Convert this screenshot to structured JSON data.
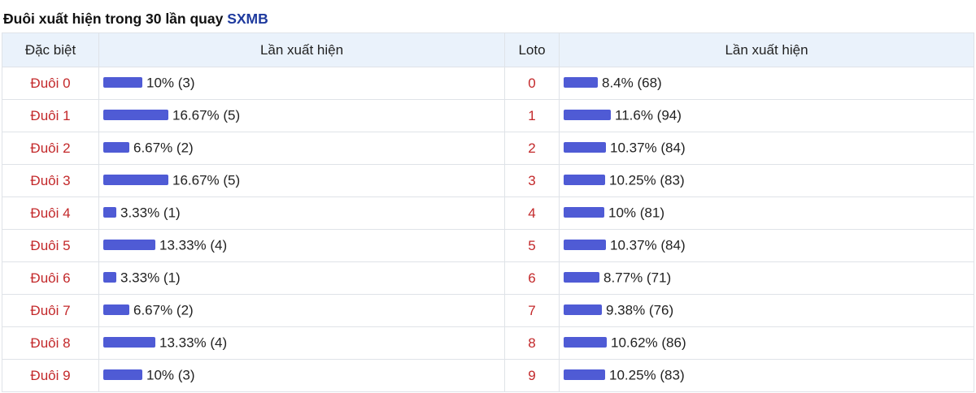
{
  "title": {
    "prefix": "Đuôi xuất hiện trong 30 lần quay",
    "brand": "SXMB"
  },
  "headers": {
    "dac_biet": "Đặc biệt",
    "lan_xuat_hien_1": "Lần xuất hiện",
    "loto": "Loto",
    "lan_xuat_hien_2": "Lần xuất hiện"
  },
  "colors": {
    "bar": "#4f5bd5",
    "label": "#c3282a",
    "brand": "#1e3a9e",
    "header_bg": "#eaf2fb"
  },
  "chart_data": [
    {
      "type": "bar",
      "title": "Đặc biệt",
      "categories": [
        "Đuôi 0",
        "Đuôi 1",
        "Đuôi 2",
        "Đuôi 3",
        "Đuôi 4",
        "Đuôi 5",
        "Đuôi 6",
        "Đuôi 7",
        "Đuôi 8",
        "Đuôi 9"
      ],
      "values": [
        10,
        16.67,
        6.67,
        16.67,
        3.33,
        13.33,
        3.33,
        6.67,
        13.33,
        10
      ],
      "counts": [
        3,
        5,
        2,
        5,
        1,
        4,
        1,
        2,
        4,
        3
      ],
      "labels": [
        "10% (3)",
        "16.67% (5)",
        "6.67% (2)",
        "16.67% (5)",
        "3.33% (1)",
        "13.33% (4)",
        "3.33% (1)",
        "6.67% (2)",
        "13.33% (4)",
        "10% (3)"
      ]
    },
    {
      "type": "bar",
      "title": "Loto",
      "categories": [
        "0",
        "1",
        "2",
        "3",
        "4",
        "5",
        "6",
        "7",
        "8",
        "9"
      ],
      "values": [
        8.4,
        11.6,
        10.37,
        10.25,
        10,
        10.37,
        8.77,
        9.38,
        10.62,
        10.25
      ],
      "counts": [
        68,
        94,
        84,
        83,
        81,
        84,
        71,
        76,
        86,
        83
      ],
      "labels": [
        "8.4% (68)",
        "11.6% (94)",
        "10.37% (84)",
        "10.25% (83)",
        "10% (81)",
        "10.37% (84)",
        "8.77% (71)",
        "9.38% (76)",
        "10.62% (86)",
        "10.25% (83)"
      ]
    }
  ]
}
